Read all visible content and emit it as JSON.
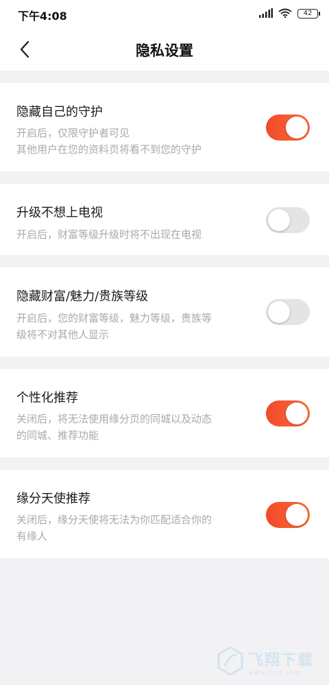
{
  "status_bar": {
    "time": "下午4:08",
    "battery": "42",
    "icons": [
      "signal-icon",
      "wifi-icon",
      "battery-icon"
    ]
  },
  "nav": {
    "title": "隐私设置",
    "back_icon": "chevron-left-icon"
  },
  "settings": [
    {
      "title": "隐藏自己的守护",
      "desc_lines": [
        "开启后，仅限守护者可见",
        "其他用户在您的资料页将看不到您的守护"
      ],
      "enabled": true
    },
    {
      "title": "升级不想上电视",
      "desc_lines": [
        "开启后，财富等级升级时将不出现在电视"
      ],
      "enabled": false
    },
    {
      "title": "隐藏财富/魅力/贵族等级",
      "desc_lines": [
        "开启后，您的财富等级，魅力等级，贵族等",
        "级将不对其他人显示"
      ],
      "enabled": false
    },
    {
      "title": "个性化推荐",
      "desc_lines": [
        "关闭后，将无法使用缘分页的同城以及动态",
        "的同城、推荐功能"
      ],
      "enabled": true
    },
    {
      "title": "缘分天使推荐",
      "desc_lines": [
        "关闭后，缘分天使将无法为你匹配适合你的",
        "有缘人"
      ],
      "enabled": true
    }
  ],
  "watermark": {
    "text": "飞翔下载",
    "sub": "www.fxxz.com"
  },
  "colors": {
    "accent": "#f04a2a",
    "toggle_off": "#e4e4e6",
    "background": "#f2f2f4"
  }
}
